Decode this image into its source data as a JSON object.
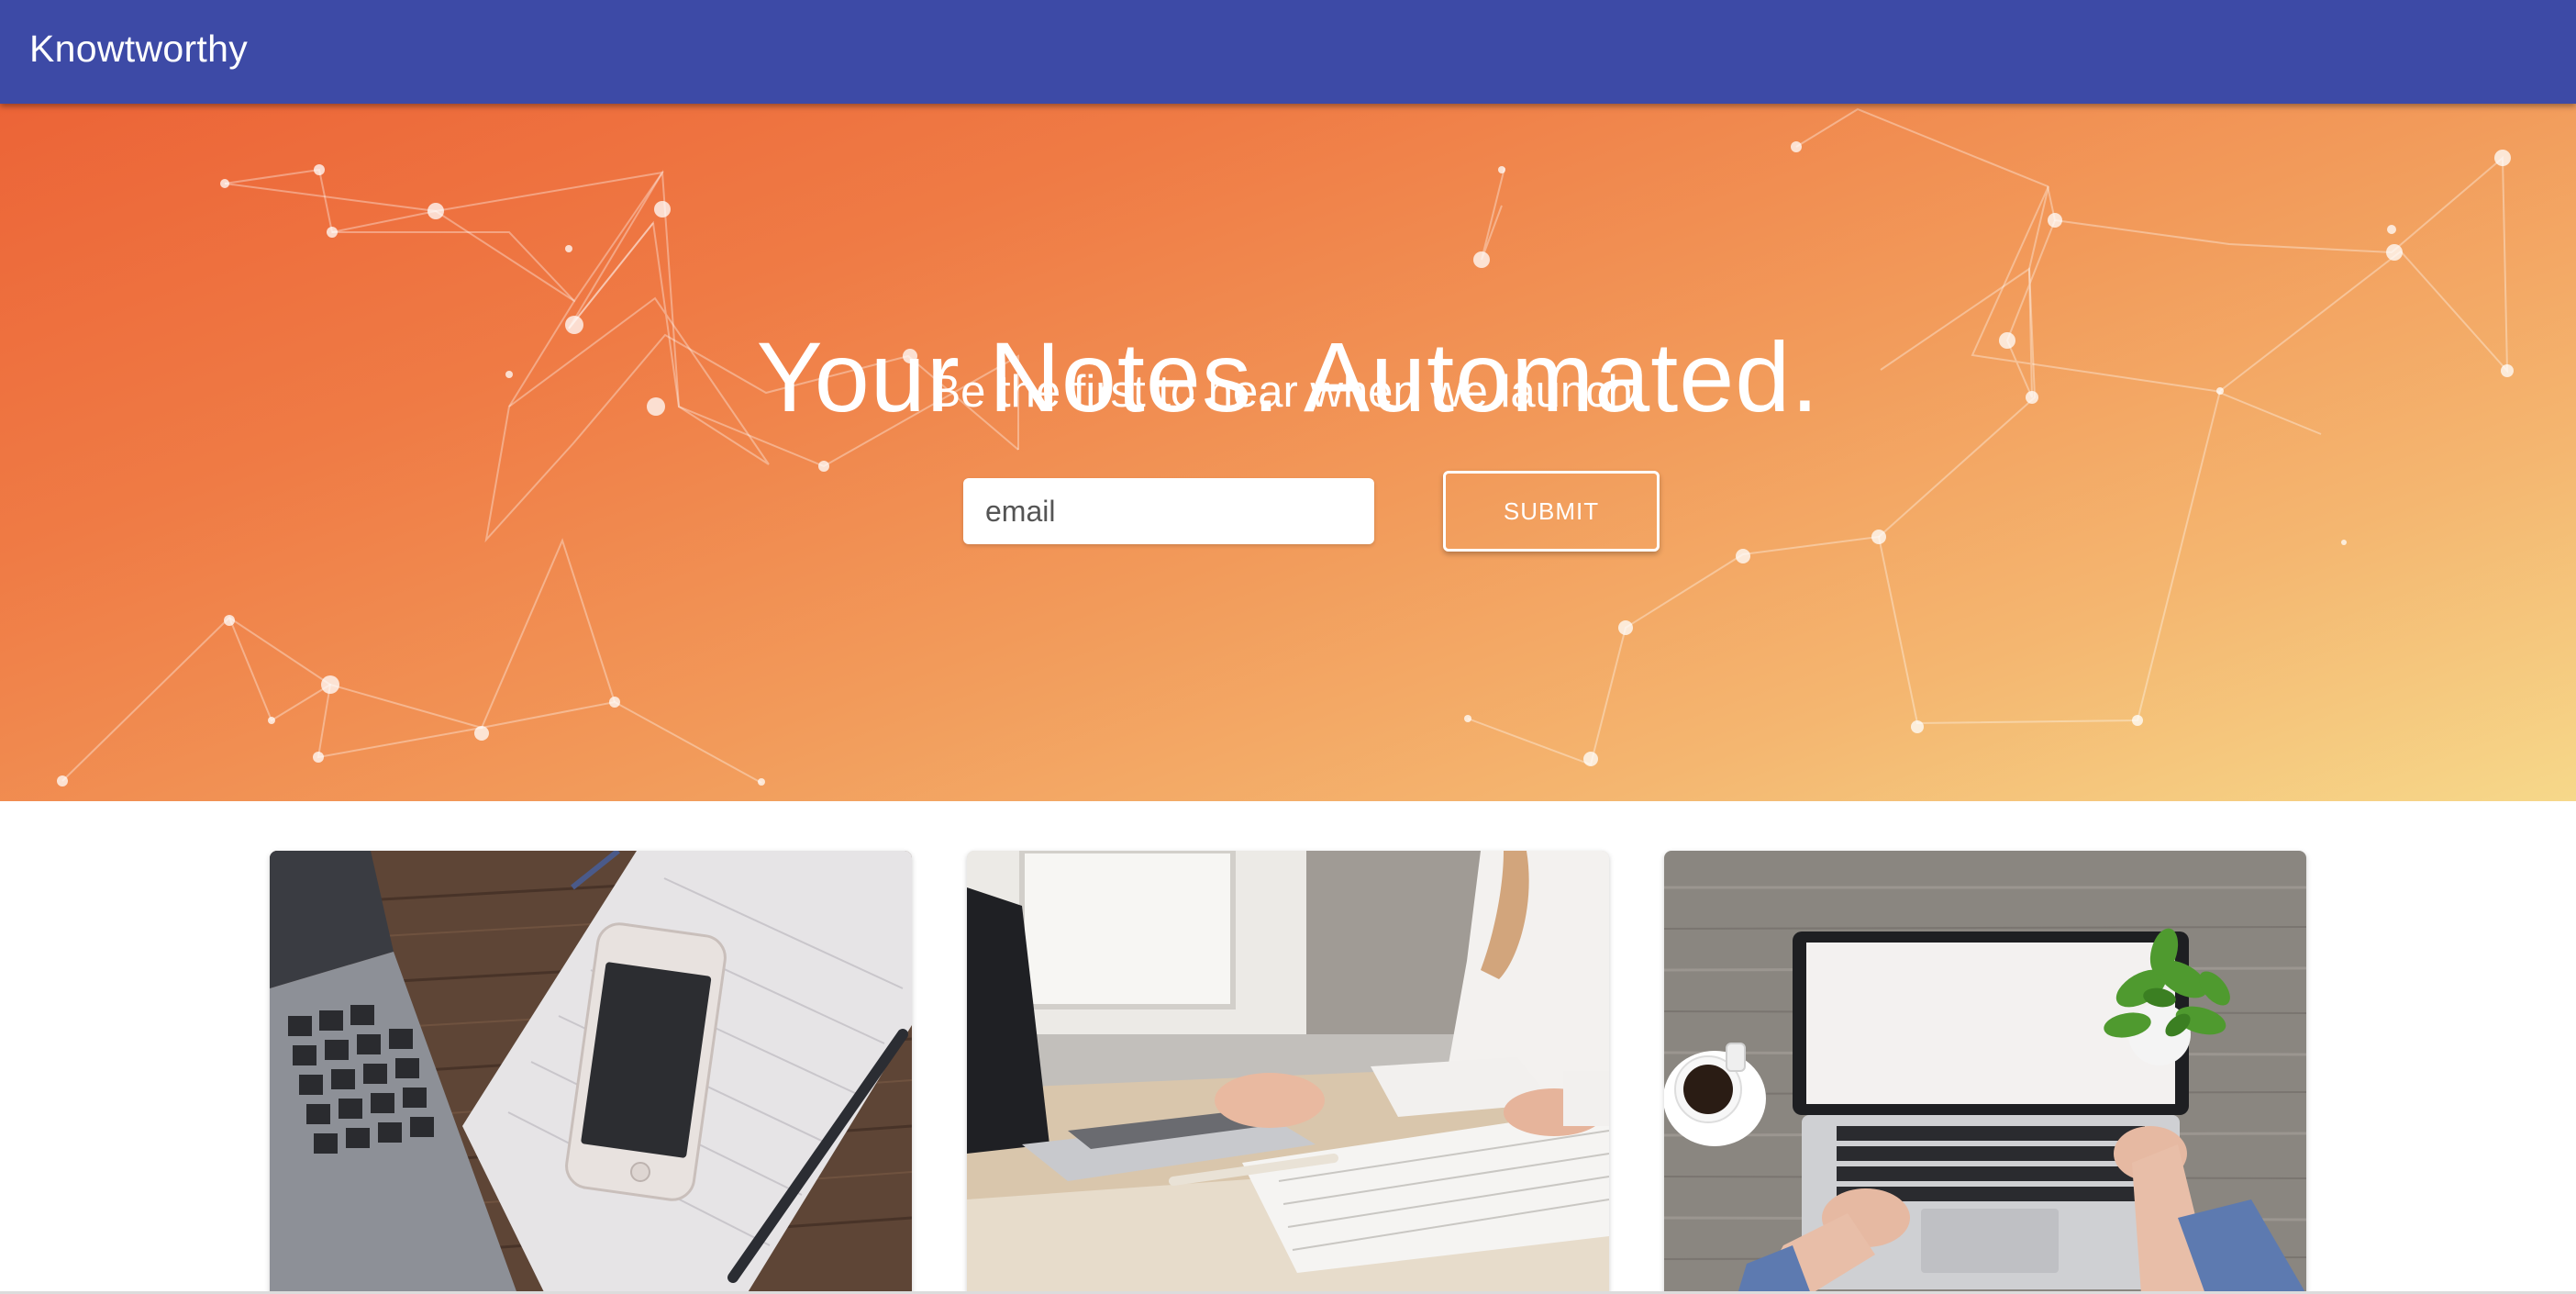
{
  "app": {
    "brand": "Knowtworthy"
  },
  "hero": {
    "title": "Your Notes. Automated.",
    "subtitle": "Be the first to hear when we launch!",
    "email_placeholder": "email",
    "submit_label": "SUBMIT"
  },
  "colors": {
    "appbar": "#3d4aa6",
    "hero_gradient_start": "#ec6437",
    "hero_gradient_end": "#f6d88a"
  },
  "cards": [
    {
      "image": "laptop-smartphone-notebook-photo"
    },
    {
      "image": "person-typing-laptop-photo"
    },
    {
      "image": "overhead-laptop-coffee-plant-photo"
    }
  ]
}
